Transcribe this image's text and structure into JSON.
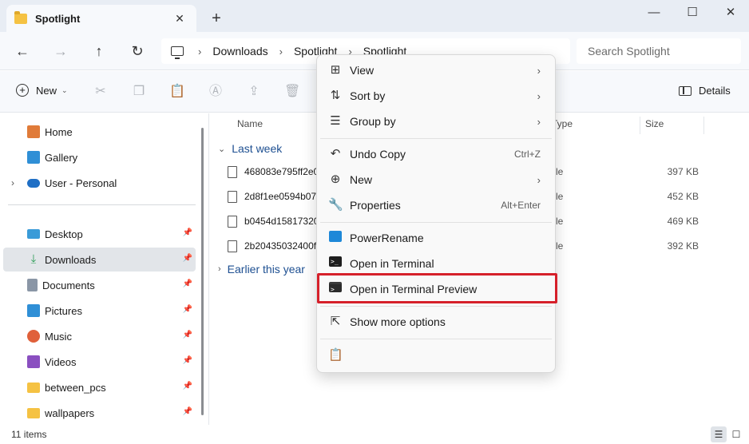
{
  "window": {
    "tab_title": "Spotlight",
    "tab_close": "✕",
    "new_tab": "+",
    "minimize": "—",
    "maximize": "☐",
    "close": "✕"
  },
  "nav": {
    "back": "←",
    "forward": "→",
    "up": "↑",
    "refresh": "↻",
    "breadcrumb_sep": "›",
    "breadcrumbs": [
      "Downloads",
      "Spotlight",
      "Spotlight"
    ],
    "search_placeholder": "Search Spotlight"
  },
  "toolbar": {
    "new_label": "New",
    "new_caret": "⌄",
    "details_label": "Details"
  },
  "sidebar": {
    "expand_glyph": "›",
    "pin_glyph": "📌",
    "items": [
      {
        "label": "Home",
        "icon": "home-icon",
        "color": "#e07b39"
      },
      {
        "label": "Gallery",
        "icon": "gallery-icon",
        "color": "#2f8fd6"
      },
      {
        "label": "User - Personal",
        "icon": "onedrive-icon",
        "color": "#1f6fc5"
      },
      {
        "label": "Desktop",
        "icon": "desktop-icon",
        "color": "#3a9bd8"
      },
      {
        "label": "Downloads",
        "icon": "download-icon",
        "color": "#2e9e58"
      },
      {
        "label": "Documents",
        "icon": "documents-icon",
        "color": "#8a96a6"
      },
      {
        "label": "Pictures",
        "icon": "pictures-icon",
        "color": "#2f8fd6"
      },
      {
        "label": "Music",
        "icon": "music-icon",
        "color": "#e0603a"
      },
      {
        "label": "Videos",
        "icon": "videos-icon",
        "color": "#8a4fc0"
      },
      {
        "label": "between_pcs",
        "icon": "folder-icon",
        "color": "#f5c243"
      },
      {
        "label": "wallpapers",
        "icon": "folder-icon",
        "color": "#f5c243"
      }
    ]
  },
  "content": {
    "columns": {
      "name": "Name",
      "type": "Type",
      "size": "Size"
    },
    "groups": [
      {
        "label": "Last week",
        "chevron": "⌄"
      },
      {
        "label": "Earlier this year",
        "chevron": "›"
      }
    ],
    "files": [
      {
        "name": "468083e795ff2e01",
        "type": "le",
        "size": "397 KB"
      },
      {
        "name": "2d8f1ee0594b073",
        "type": "le",
        "size": "452 KB"
      },
      {
        "name": "b0454d15817320c",
        "type": "le",
        "size": "469 KB"
      },
      {
        "name": "2b20435032400fd",
        "type": "le",
        "size": "392 KB"
      }
    ]
  },
  "status": {
    "item_count": "11 items"
  },
  "context_menu": {
    "submenu_arrow": "›",
    "items": [
      {
        "label": "View",
        "icon": "grid-icon",
        "glyph": "⊞",
        "submenu": true
      },
      {
        "label": "Sort by",
        "icon": "sort-icon",
        "glyph": "⇅",
        "submenu": true
      },
      {
        "label": "Group by",
        "icon": "group-icon",
        "glyph": "☰",
        "submenu": true
      },
      {
        "label": "Undo Copy",
        "icon": "undo-icon",
        "glyph": "↶",
        "shortcut": "Ctrl+Z"
      },
      {
        "label": "New",
        "icon": "new-icon",
        "glyph": "⊕",
        "submenu": true
      },
      {
        "label": "Properties",
        "icon": "properties-icon",
        "glyph": "🔧",
        "shortcut": "Alt+Enter"
      },
      {
        "label": "PowerRename",
        "icon": "powerrename-icon"
      },
      {
        "label": "Open in Terminal",
        "icon": "terminal-icon"
      },
      {
        "label": "Open in Terminal Preview",
        "icon": "terminal-preview-icon"
      },
      {
        "label": "Show more options",
        "icon": "share-icon",
        "glyph": "⇱"
      },
      {
        "label": "",
        "icon": "clipboard-icon",
        "glyph": "📋"
      }
    ],
    "highlight_color": "#d6202a"
  }
}
